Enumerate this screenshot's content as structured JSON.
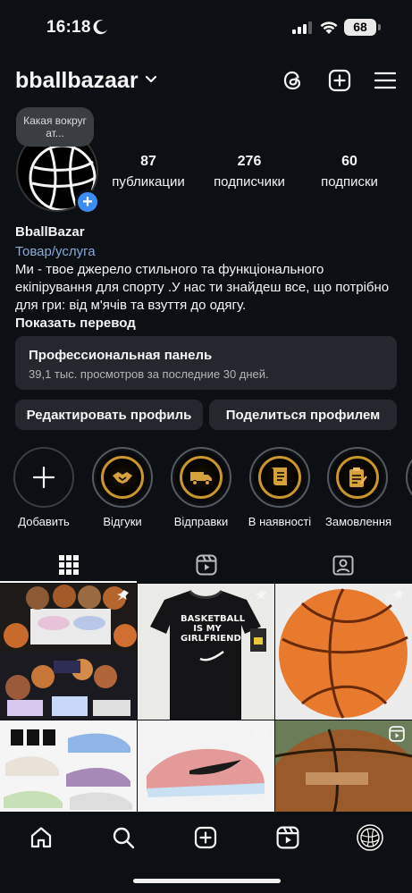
{
  "status": {
    "time": "16:18",
    "battery": "68"
  },
  "header": {
    "username": "bballbazaar"
  },
  "note": {
    "text": "Какая вокруг ат..."
  },
  "stats": [
    {
      "num": "87",
      "label": "публикации"
    },
    {
      "num": "276",
      "label": "подписчики"
    },
    {
      "num": "60",
      "label": "подписки"
    }
  ],
  "bio": {
    "name": "BballBazar",
    "category": "Товар/услуга",
    "text": "Ми - твое джерело стильного та функціонального екіпірування для спорту .У нас ти знайдеш все, що потрібно для гри: від м'ячів та взуття до одягу.",
    "translate": "Показать перевод"
  },
  "panel": {
    "title": "Профессиональная панель",
    "subtitle": "39,1 тыс. просмотров за последние 30 дней."
  },
  "buttons": {
    "edit": "Редактировать профиль",
    "share": "Поделиться профилем"
  },
  "highlights": [
    {
      "label": "Добавить",
      "icon": "plus-icon"
    },
    {
      "label": "Відгуки",
      "icon": "handshake-icon"
    },
    {
      "label": "Відправки",
      "icon": "truck-icon"
    },
    {
      "label": "В наявності",
      "icon": "scroll-icon"
    },
    {
      "label": "Замовлення",
      "icon": "clipboard-icon"
    }
  ],
  "tabs": [
    "grid-icon",
    "reels-icon",
    "tagged-icon"
  ],
  "posts": [
    {
      "icon": "pin-icon",
      "caption": ""
    },
    {
      "icon": "pin-icon",
      "caption": "BASKETBALL IS MY GIRLFRIEND"
    },
    {
      "icon": "pin-icon",
      "caption": ""
    },
    {
      "icon": "",
      "caption": ""
    },
    {
      "icon": "multi-icon",
      "caption": ""
    },
    {
      "icon": "reel-icon",
      "caption": ""
    }
  ],
  "nav": [
    "home-icon",
    "search-icon",
    "create-icon",
    "reels-icon",
    "profile-icon"
  ]
}
